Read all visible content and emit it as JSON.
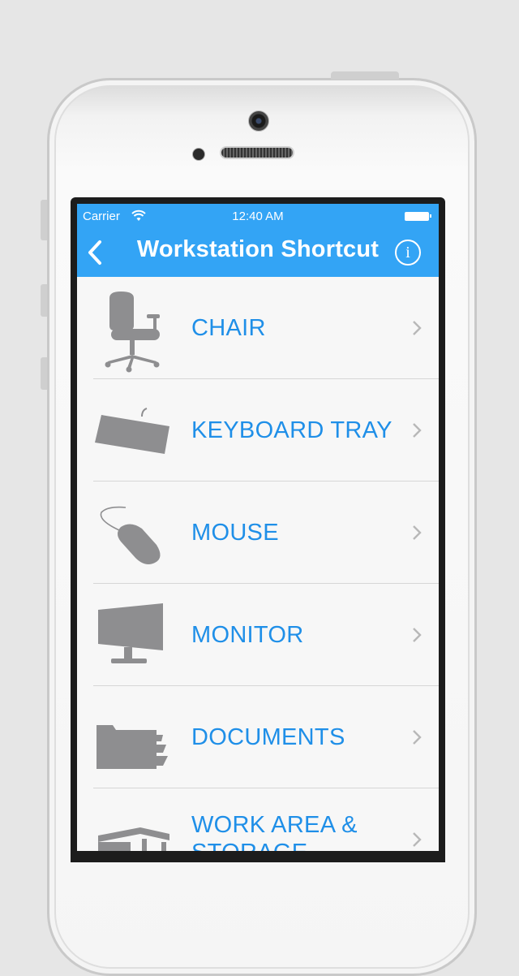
{
  "status_bar": {
    "carrier": "Carrier",
    "time": "12:40 AM"
  },
  "nav": {
    "title": "Workstation Shortcut",
    "back_icon": "chevron-left-icon",
    "info_icon": "info-icon",
    "info_glyph": "i"
  },
  "items": [
    {
      "label": "CHAIR",
      "icon": "chair-icon"
    },
    {
      "label": "KEYBOARD TRAY",
      "icon": "keyboard-icon"
    },
    {
      "label": "MOUSE",
      "icon": "mouse-icon"
    },
    {
      "label": "MONITOR",
      "icon": "monitor-icon"
    },
    {
      "label": "DOCUMENTS",
      "icon": "folder-icon"
    },
    {
      "label": "WORK AREA & STORAGE",
      "icon": "desk-icon"
    }
  ],
  "colors": {
    "navbar": "#33a4f5",
    "label": "#1f8fe8",
    "icon": "#8e8e90",
    "chevron": "#b8b8b8"
  }
}
